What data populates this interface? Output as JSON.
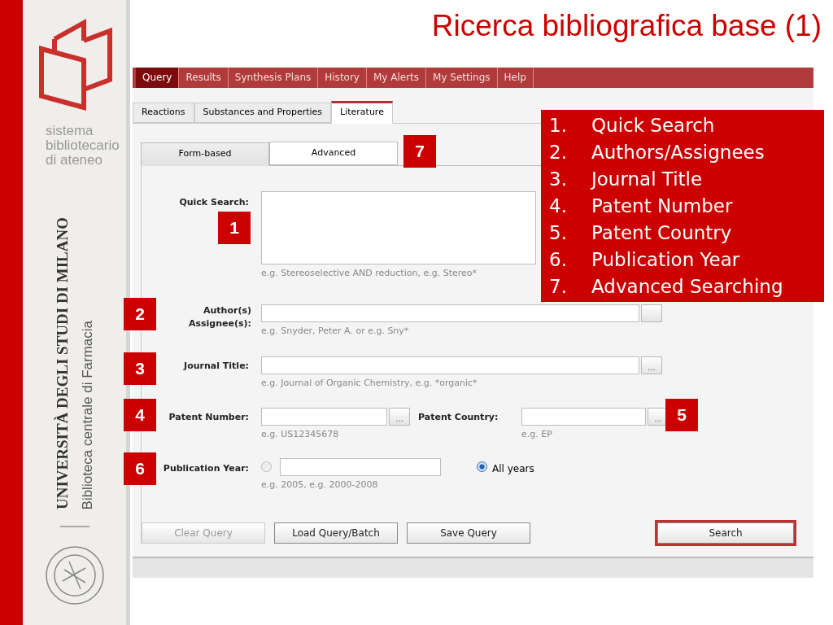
{
  "slide": {
    "title": "Ricerca bibliografica base (1)"
  },
  "sidebar": {
    "logo_lines": [
      "sistema",
      "bibliotecario",
      "di ateneo"
    ],
    "university": "UNIVERSITÀ DEGLI STUDI DI MILANO",
    "library": "Biblioteca centrale di Farmacia"
  },
  "menu": [
    {
      "label": "Query",
      "selected": true
    },
    {
      "label": "Results",
      "selected": false
    },
    {
      "label": "Synthesis Plans",
      "selected": false
    },
    {
      "label": "History",
      "selected": false
    },
    {
      "label": "My Alerts",
      "selected": false
    },
    {
      "label": "My Settings",
      "selected": false
    },
    {
      "label": "Help",
      "selected": false
    }
  ],
  "subtabs": [
    {
      "label": "Reactions",
      "selected": false
    },
    {
      "label": "Substances and Properties",
      "selected": false
    },
    {
      "label": "Literature",
      "selected": true
    }
  ],
  "form_tabs": [
    {
      "label": "Form-based",
      "selected": true
    },
    {
      "label": "Advanced",
      "selected": false
    }
  ],
  "quick_search": {
    "label": "Quick Search:",
    "hint": "e.g. Stereoselective AND reduction, e.g. Stereo*"
  },
  "authors": {
    "label_lines": [
      "Author(s)",
      "Assignee(s):"
    ],
    "hint": "e.g. Snyder, Peter A. or e.g. Sny*"
  },
  "journal": {
    "label": "Journal Title:",
    "hint": "e.g. Journal of Organic Chemistry, e.g. *organic*",
    "lookup": "..."
  },
  "patent_number": {
    "label": "Patent Number:",
    "hint": "e.g. US12345678",
    "lookup": "..."
  },
  "patent_country": {
    "label": "Patent Country:",
    "hint": "e.g. EP",
    "lookup": "..."
  },
  "publication_year": {
    "label": "Publication Year:",
    "hint": "e.g. 2005, e.g. 2000-2008",
    "range_selected": false,
    "all_label": "All years",
    "all_selected": true
  },
  "buttons": [
    {
      "label": "Clear Query",
      "disabled": true,
      "primary": false
    },
    {
      "label": "Load Query/Batch",
      "disabled": false,
      "primary": false
    },
    {
      "label": "Save Query",
      "disabled": false,
      "primary": false
    },
    {
      "label": "Search",
      "disabled": false,
      "primary": true
    }
  ],
  "callouts": [
    "1",
    "2",
    "3",
    "4",
    "5",
    "6",
    "7"
  ],
  "legend": [
    {
      "number": "1.",
      "text": "Quick Search"
    },
    {
      "number": "2.",
      "text": "Authors/Assignees"
    },
    {
      "number": "3.",
      "text": "Journal Title"
    },
    {
      "number": "4.",
      "text": "Patent Number"
    },
    {
      "number": "5.",
      "text": "Patent Country"
    },
    {
      "number": "6.",
      "text": "Publication Year"
    },
    {
      "number": "7.",
      "text": "Advanced Searching"
    }
  ]
}
